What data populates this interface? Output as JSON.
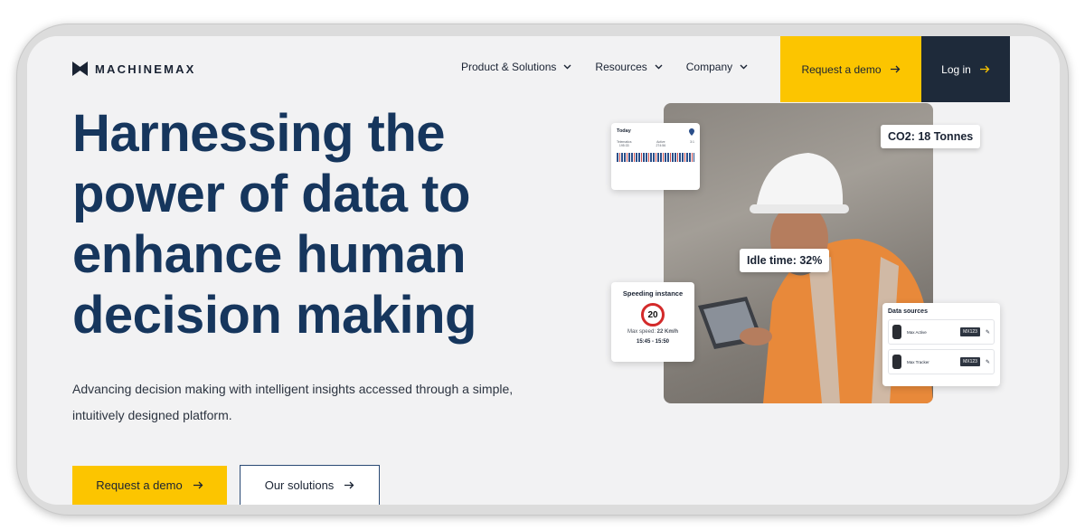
{
  "header": {
    "logo_text": "MACHINEMAX",
    "nav": [
      {
        "label": "Product & Solutions"
      },
      {
        "label": "Resources"
      },
      {
        "label": "Company"
      }
    ],
    "demo_label": "Request a demo",
    "login_label": "Log in"
  },
  "hero": {
    "headline_lines": [
      "Harnessing the",
      "power of data to",
      "enhance human",
      "decision making"
    ],
    "subtext_lines": [
      "Advancing decision making with intelligent insights accessed through a simple,",
      "intuitively designed platform."
    ],
    "cta_primary": "Request a demo",
    "cta_secondary": "Our solutions"
  },
  "overlays": {
    "co2": "CO2: 18 Tonnes",
    "idle": "Idle time: 32%",
    "today": {
      "title": "Today",
      "cells": [
        {
          "label": "Telematics",
          "value": "195:33"
        },
        {
          "label": "Active",
          "value": "274:56"
        },
        {
          "label": "",
          "value": "3:1"
        }
      ]
    },
    "speeding": {
      "title": "Speeding instance",
      "sign": "20",
      "max_speed_label": "Max speed:",
      "max_speed_value": "22 Km/h",
      "time": "15:45 - 15:50"
    },
    "data_sources": {
      "title": "Data sources",
      "items": [
        {
          "name": "Max Active",
          "id": "MX123"
        },
        {
          "name": "Max Tracker",
          "id": "MX123"
        }
      ]
    }
  },
  "colors": {
    "accent_yellow": "#fcc500",
    "navy": "#16365d",
    "dark_button": "#1e2a3a",
    "background": "#f2f2f3"
  }
}
